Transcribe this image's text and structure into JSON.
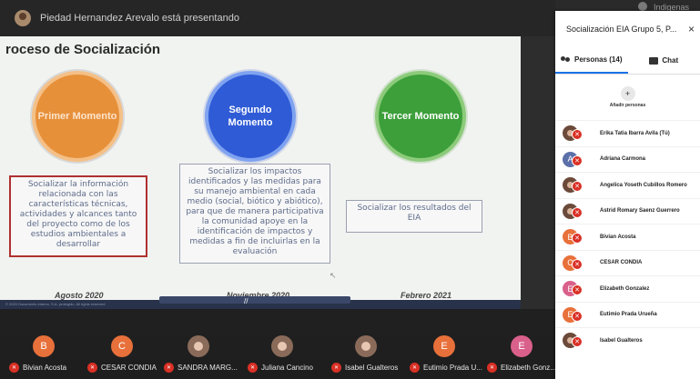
{
  "presenting_banner": "Piedad Hernandez Arevalo está presentando",
  "top_right_name": "Indigenas",
  "slide": {
    "title": "roceso de Socialización",
    "moments": [
      {
        "label": "Primer Momento",
        "color": "#e7903a"
      },
      {
        "label": "Segundo Momento",
        "color": "#2f5bd6"
      },
      {
        "label": "Tercer Momento",
        "color": "#3c9f3a"
      }
    ],
    "box1": "Socializar la información relacionada con las características técnicas, actividades y alcances tanto del proyecto como de los estudios ambientales a desarrollar",
    "box2": "Socializar los impactos identificados y las medidas para su manejo ambiental en cada medio (social, biótico y abiótico), para que de manera participativa la comunidad apoye en la identificación de impactos y medidas a fin de incluirlas en la evaluación",
    "box3": "Socializar los resultados del EIA",
    "dates": [
      "Agosto 2020",
      "Noviembre 2020",
      "Febrero 2021"
    ],
    "footer_text": "© 2020 Documento interno, S.A. protegido. All rights reserved"
  },
  "panel": {
    "title": "Socialización EIA Grupo 5, P...",
    "close_icon": "×",
    "tab_people": "Personas (14)",
    "tab_chat": "Chat",
    "add_people": "Añadir personas",
    "participants": [
      {
        "name": "Erika Tatia Ibarra Avila (Tú)",
        "initial": "",
        "color": "#6b4a3a",
        "photo": true
      },
      {
        "name": "Adriana Carmona",
        "initial": "A",
        "color": "#5b6fa8",
        "photo": false
      },
      {
        "name": "Angelica Yoseth Cubillos Romero",
        "initial": "",
        "color": "#6b4a3a",
        "photo": true
      },
      {
        "name": "Astrid Romary Saenz Guerrero",
        "initial": "",
        "color": "#6b4a3a",
        "photo": true
      },
      {
        "name": "Bivian Acosta",
        "initial": "B",
        "color": "#e8703a",
        "photo": false
      },
      {
        "name": "CESAR CONDIA",
        "initial": "C",
        "color": "#e8703a",
        "photo": false
      },
      {
        "name": "Elizabeth Gonzalez",
        "initial": "E",
        "color": "#d9608a",
        "photo": false
      },
      {
        "name": "Eutimio Prada Urueña",
        "initial": "E",
        "color": "#e8703a",
        "photo": false
      },
      {
        "name": "Isabel Gualteros",
        "initial": "",
        "color": "#6b4a3a",
        "photo": true
      }
    ]
  },
  "bottom_tiles": [
    {
      "name": "Bivian Acosta",
      "initial": "B",
      "color": "#e8703a",
      "photo": false
    },
    {
      "name": "CESAR CONDIA",
      "initial": "C",
      "color": "#e8703a",
      "photo": false
    },
    {
      "name": "SANDRA MARG...",
      "initial": "",
      "color": "#8a6b5a",
      "photo": true
    },
    {
      "name": "Juliana Cancino",
      "initial": "",
      "color": "#8a6b5a",
      "photo": true
    },
    {
      "name": "Isabel Gualteros",
      "initial": "",
      "color": "#8a6b5a",
      "photo": true
    },
    {
      "name": "Eutimio Prada U...",
      "initial": "E",
      "color": "#e8703a",
      "photo": false
    },
    {
      "name": "Elizabeth Gonz...",
      "initial": "E",
      "color": "#d9608a",
      "photo": false
    }
  ]
}
